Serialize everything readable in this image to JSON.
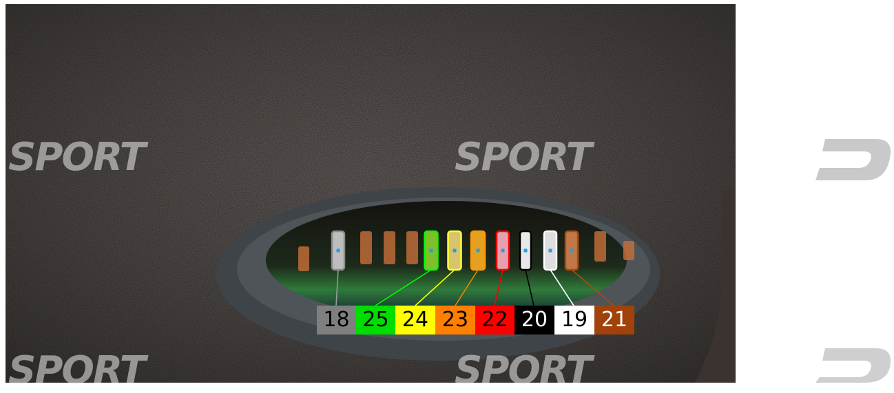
{
  "watermark": {
    "text": "SPORT",
    "color": "#d9d9d9"
  },
  "connector": {
    "pins": [
      {
        "label": "18",
        "bg": "#7f7f7f",
        "fg": "#000000",
        "line": "#9a9a9a",
        "pad": "#bdbdbd",
        "outline": "#8c8c8c"
      },
      {
        "label": "25",
        "bg": "#00dd00",
        "fg": "#000000",
        "line": "#00ff00",
        "pad": "#7fbf2a",
        "outline": "#00ff00"
      },
      {
        "label": "24",
        "bg": "#ffff00",
        "fg": "#000000",
        "line": "#ffff00",
        "pad": "#d9c46e",
        "outline": "#ffff33"
      },
      {
        "label": "23",
        "bg": "#ff7f00",
        "fg": "#000000",
        "line": "#ff8000",
        "pad": "#e6a020",
        "outline": "#ff9900"
      },
      {
        "label": "22",
        "bg": "#ff0000",
        "fg": "#000000",
        "line": "#ff0000",
        "pad": "#e8a0b0",
        "outline": "#ff0000"
      },
      {
        "label": "20",
        "bg": "#000000",
        "fg": "#ffffff",
        "line": "#000000",
        "pad": "#e8e8e8",
        "outline": "#000000"
      },
      {
        "label": "19",
        "bg": "#ffffff",
        "fg": "#000000",
        "line": "#ffffff",
        "pad": "#dedede",
        "outline": "#ffffff"
      },
      {
        "label": "21",
        "bg": "#a0420a",
        "fg": "#ffffff",
        "line": "#b04a10",
        "pad": "#c07848",
        "outline": "#b04a10"
      }
    ]
  }
}
